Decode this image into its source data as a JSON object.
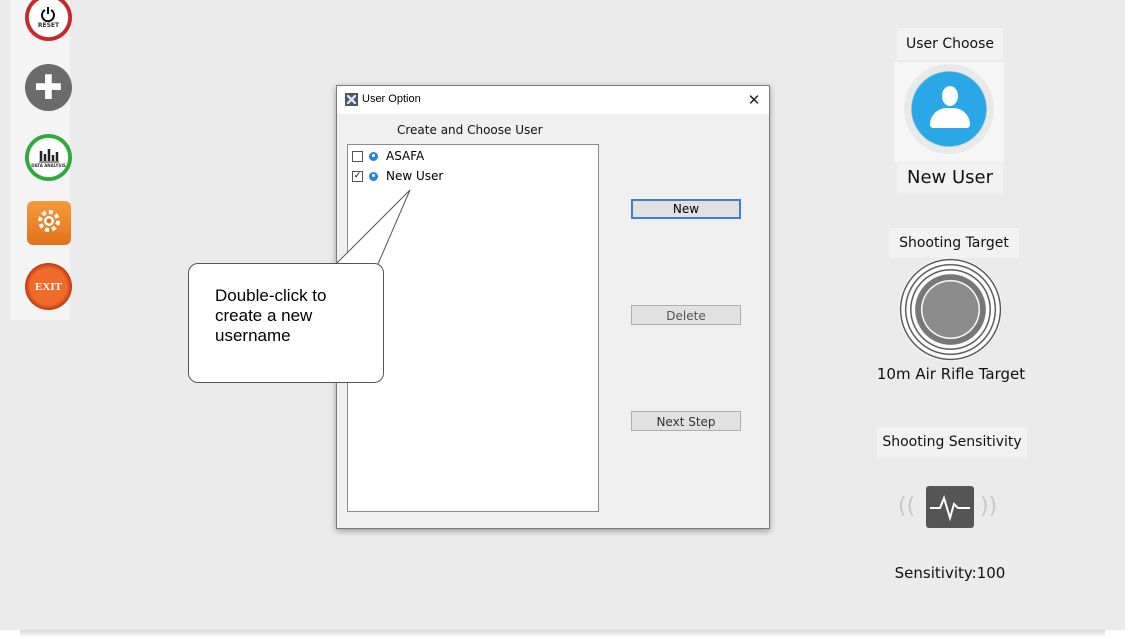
{
  "toolbar": {
    "reset_label": "RESET",
    "data_label": "DATA ANALYSIS",
    "exit_label": "EXIT"
  },
  "dialog": {
    "title": "User Option",
    "close_glyph": "✕",
    "list_caption": "Create and Choose User",
    "users": [
      {
        "name": "ASAFA",
        "checked": false
      },
      {
        "name": "New User",
        "checked": true
      }
    ],
    "buttons": {
      "new": "New",
      "delete": "Delete",
      "next": "Next Step"
    }
  },
  "callout": {
    "text": "Double-click to create a new username"
  },
  "right_panel": {
    "user_choose_label": "User Choose",
    "selected_user": "New User",
    "shooting_target_label": "Shooting Target",
    "target_name": "10m Air Rifle Target",
    "shooting_sensitivity_label": "Shooting Sensitivity",
    "sensitivity_text": "Sensitivity:100"
  },
  "colors": {
    "accent": "#3c7fd8",
    "avatar_blue": "#2aa7e6",
    "background": "#ebebeb"
  }
}
